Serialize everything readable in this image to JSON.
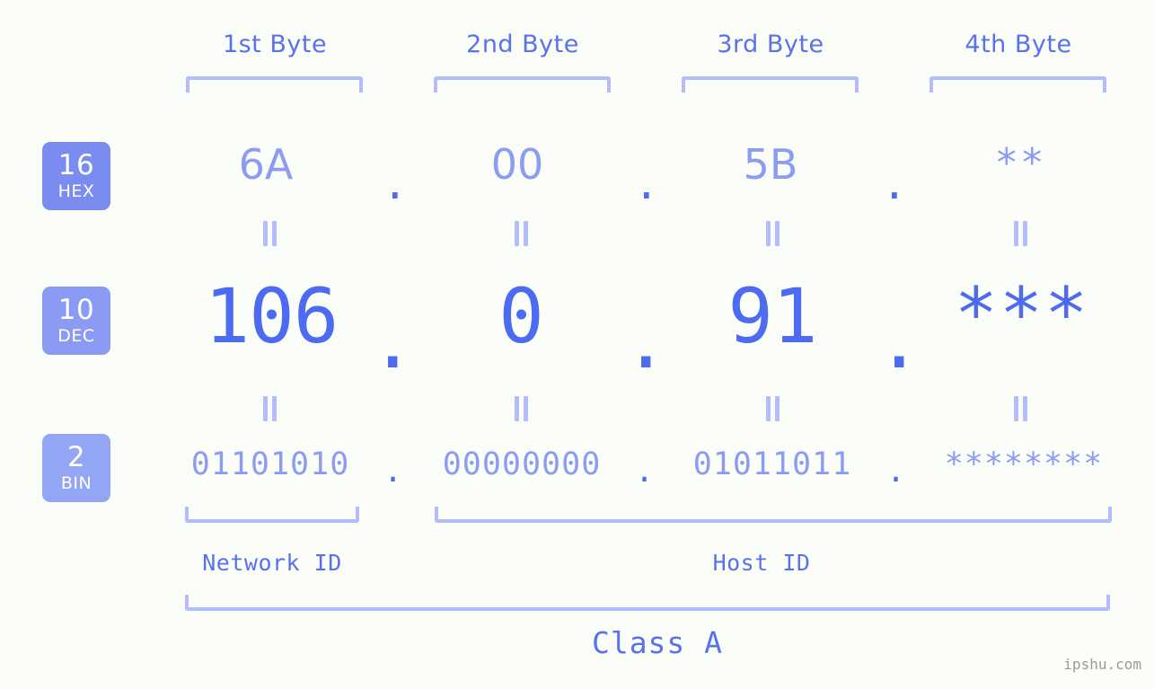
{
  "page": {
    "background_color": "#fbfdf8",
    "accent_color": "#4d6bf0",
    "light_accent_color": "#8d9cf3",
    "bracket_color": "#b4bdfb"
  },
  "byte_headers": [
    {
      "label": "1st Byte"
    },
    {
      "label": "2nd Byte"
    },
    {
      "label": "3rd Byte"
    },
    {
      "label": "4th Byte"
    }
  ],
  "rows": [
    {
      "badge_number": "16",
      "badge_abbr": "HEX",
      "badge_color": "#7b8cf0",
      "values": [
        "6A",
        "00",
        "5B",
        "**"
      ],
      "separators": [
        ".",
        ".",
        "."
      ]
    },
    {
      "badge_number": "10",
      "badge_abbr": "DEC",
      "badge_color": "#8b9bf3",
      "values": [
        "106",
        "0",
        "91",
        "***"
      ],
      "separators": [
        ".",
        ".",
        "."
      ]
    },
    {
      "badge_number": "2",
      "badge_abbr": "BIN",
      "badge_color": "#93a6f5",
      "values": [
        "01101010",
        "00000000",
        "01011011",
        "********"
      ],
      "separators": [
        ".",
        ".",
        "."
      ]
    }
  ],
  "equality_marks": {
    "symbol": "=",
    "count_per_gap": 4
  },
  "footer": {
    "network_id_label": "Network ID",
    "host_id_label": "Host ID",
    "class_label": "Class A",
    "watermark": "ipshu.com"
  }
}
